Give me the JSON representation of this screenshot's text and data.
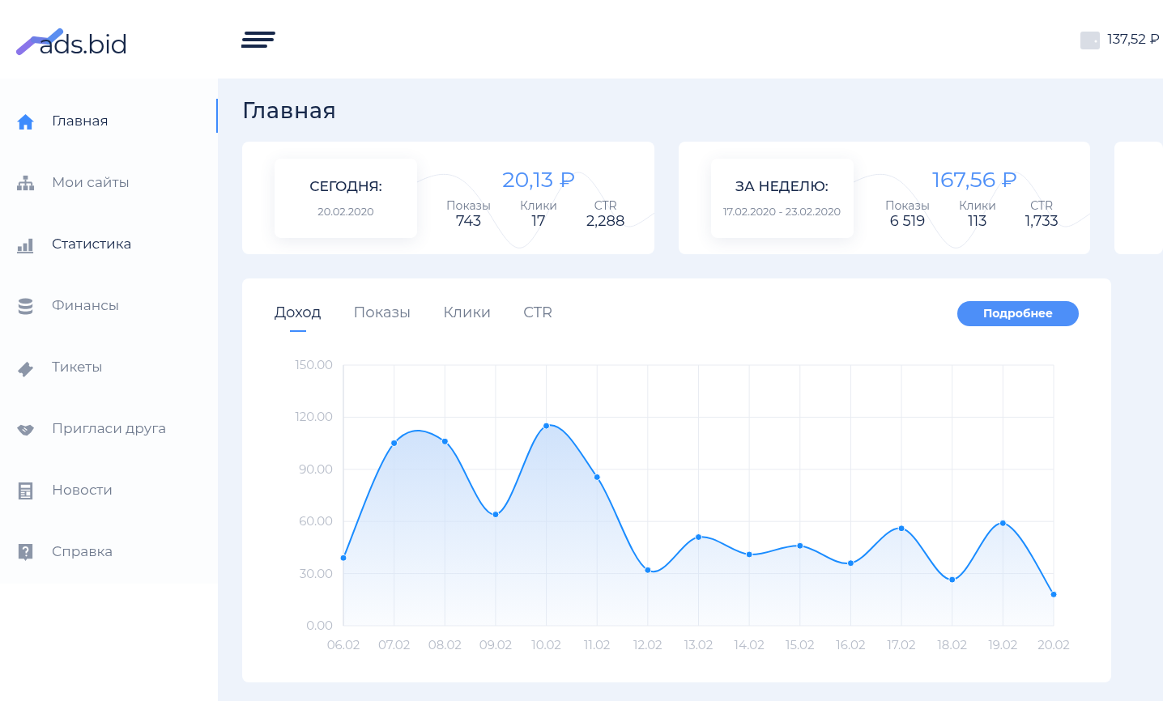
{
  "logo": {
    "text": "ads.bid"
  },
  "balance": "137,52 ₽",
  "sidebar": {
    "items": [
      {
        "label": "Главная",
        "selected": true,
        "highlighted": true
      },
      {
        "label": "Мои сайты",
        "selected": false,
        "highlighted": false
      },
      {
        "label": "Статистика",
        "selected": false,
        "highlighted": true
      },
      {
        "label": "Финансы",
        "selected": false,
        "highlighted": false
      },
      {
        "label": "Тикеты",
        "selected": false,
        "highlighted": false
      },
      {
        "label": "Пригласи друга",
        "selected": false,
        "highlighted": false
      },
      {
        "label": "Новости",
        "selected": false,
        "highlighted": false
      },
      {
        "label": "Справка",
        "selected": false,
        "highlighted": false
      }
    ]
  },
  "page_title": "Главная",
  "summary_cards": [
    {
      "title": "СЕГОДНЯ:",
      "date": "20.02.2020",
      "amount": "20,13 ₽",
      "stats": [
        {
          "label": "Показы",
          "value": "743"
        },
        {
          "label": "Клики",
          "value": "17"
        },
        {
          "label": "CTR",
          "value": "2,288"
        }
      ]
    },
    {
      "title": "ЗА НЕДЕЛЮ:",
      "date": "17.02.2020 - 23.02.2020",
      "amount": "167,56 ₽",
      "stats": [
        {
          "label": "Показы",
          "value": "6 519"
        },
        {
          "label": "Клики",
          "value": "113"
        },
        {
          "label": "CTR",
          "value": "1,733"
        }
      ]
    }
  ],
  "chart_panel": {
    "tabs": [
      {
        "label": "Доход",
        "selected": true
      },
      {
        "label": "Показы",
        "selected": false
      },
      {
        "label": "Клики",
        "selected": false
      },
      {
        "label": "CTR",
        "selected": false
      }
    ],
    "button": "Подробнее",
    "chart_data": {
      "type": "area",
      "categories": [
        "06.02",
        "07.02",
        "08.02",
        "09.02",
        "10.02",
        "11.02",
        "12.02",
        "13.02",
        "14.02",
        "15.02",
        "16.02",
        "17.02",
        "18.02",
        "19.02",
        "20.02"
      ],
      "grid": true,
      "series": [
        {
          "color": "#1a8cff",
          "values": [
            39,
            105,
            106,
            64,
            115,
            85.5,
            32,
            51,
            41,
            46,
            36,
            56,
            26.5,
            59,
            18
          ]
        }
      ],
      "ylim": [
        0,
        150
      ],
      "yticks": [
        {
          "value": 0,
          "label": "0.00"
        },
        {
          "value": 30,
          "label": "30.00"
        },
        {
          "value": 60,
          "label": "60.00"
        },
        {
          "value": 90,
          "label": "90.00"
        },
        {
          "value": 120,
          "label": "120.00"
        },
        {
          "value": 150,
          "label": "150.00"
        }
      ]
    }
  }
}
